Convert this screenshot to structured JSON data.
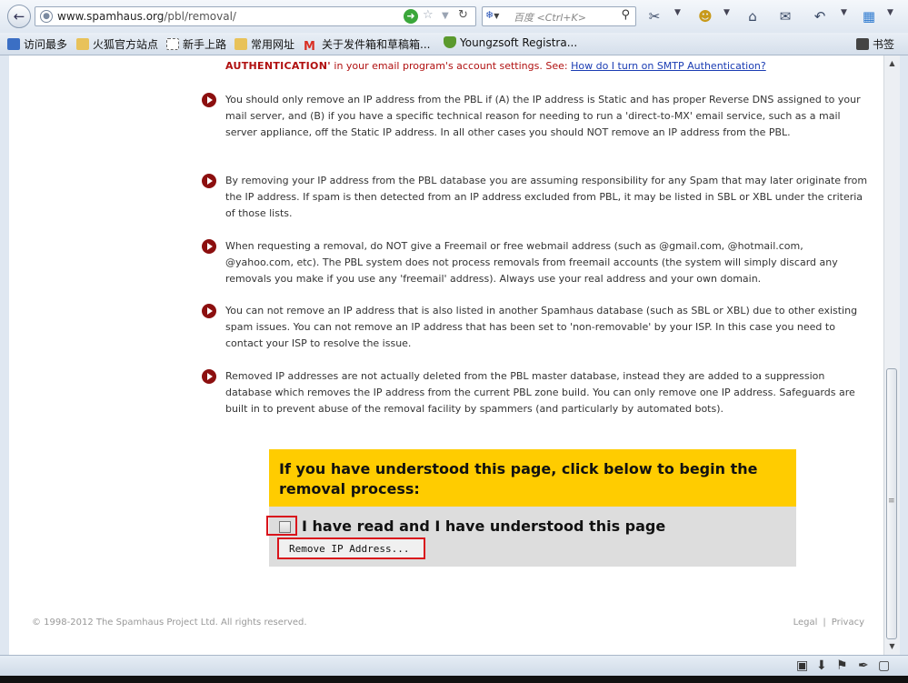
{
  "browser": {
    "url_host": "www.spamhaus.org",
    "url_path": "/pbl/removal/",
    "search_placeholder": "百度 <Ctrl+K>",
    "bookmarks": [
      {
        "label": "访问最多",
        "icon": "most-visited-icon",
        "color": "#3b6fc4"
      },
      {
        "label": "火狐官方站点",
        "icon": "folder-icon",
        "color": "#e8c25a"
      },
      {
        "label": "新手上路",
        "icon": "dotted-page-icon",
        "color": "#ffffff"
      },
      {
        "label": "常用网址",
        "icon": "folder-icon",
        "color": "#e8c25a"
      },
      {
        "label": "关于发件箱和草稿箱...",
        "icon": "gmail-icon",
        "color": "#d93025"
      },
      {
        "label": "Youngzsoft Registra...",
        "icon": "shield-icon",
        "color": "#5b9a2e"
      }
    ],
    "bookmarks_menu_label": "书签"
  },
  "page": {
    "top_line_bold": "AUTHENTICATION'",
    "top_line_rest": " in your email program's account settings. See: ",
    "top_line_link": "How do I turn on SMTP Authentication?",
    "paragraphs": [
      "You should only remove an IP address from the PBL if (A) the IP address is Static and has proper Reverse DNS assigned to your mail server, and (B) if you have a specific technical reason for needing to run a 'direct-to-MX' email service, such as a mail server appliance, off the Static IP address. In all other cases you should NOT remove an IP address from the PBL.",
      "By removing your IP address from the PBL database you are assuming responsibility for any Spam that may later originate from the IP address. If spam is then detected from an IP address excluded from PBL, it may be listed in SBL or XBL under the criteria of those lists.",
      "When requesting a removal, do NOT give a Freemail or free webmail address (such as @gmail.com, @hotmail.com, @yahoo.com, etc). The PBL system does not process removals from freemail accounts (the system will simply discard any removals you make if you use any 'freemail' address). Always use your real address and your own domain.",
      "You can not remove an IP address that is also listed in another Spamhaus database (such as SBL or XBL) due to other existing spam issues. You can not remove an IP address that has been set to 'non-removable' by your ISP. In this case you need to contact your ISP to resolve the issue.",
      "Removed IP addresses are not actually deleted from the PBL master database, instead they are added to a suppression database which removes the IP address from the current PBL zone build. You can only remove one IP address. Safeguards are built in to prevent abuse of the removal facility by spammers (and particularly by automated bots)."
    ],
    "removal_title": "If you have understood this page, click below to begin the removal process:",
    "ack_label": "I have read and I have understood this page",
    "ack_checked": false,
    "remove_button": "Remove IP Address...",
    "footer_copyright": "© 1998-2012 The Spamhaus Project Ltd. All rights reserved.",
    "footer_legal": "Legal",
    "footer_sep": "|",
    "footer_privacy": "Privacy"
  },
  "colors": {
    "bullet": "#8c0f0f",
    "warning_text": "#b01010",
    "removal_header_bg": "#ffcc00",
    "highlight_border": "#d9141c"
  }
}
